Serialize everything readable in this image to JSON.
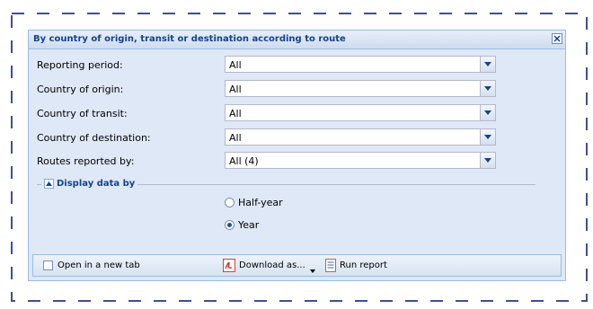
{
  "panel": {
    "title": "By country of origin, transit or destination according to route"
  },
  "form": {
    "rows": [
      {
        "label": "Reporting period:",
        "value": "All"
      },
      {
        "label": "Country of origin:",
        "value": "All"
      },
      {
        "label": "Country of transit:",
        "value": "All"
      },
      {
        "label": "Country of destination:",
        "value": "All"
      },
      {
        "label": "Routes reported by:",
        "value": "All (4)"
      }
    ]
  },
  "display": {
    "legend": "Display data by",
    "options": [
      {
        "label": "Half-year",
        "selected": false
      },
      {
        "label": "Year",
        "selected": true
      }
    ]
  },
  "footer": {
    "open_new_tab_label": "Open in a new tab",
    "open_new_tab_checked": false,
    "download_label": "Download as...",
    "run_report_label": "Run report"
  },
  "colors": {
    "frame_dash": "#3f4f8f",
    "panel_bg": "#dfe8f6",
    "header_text": "#15428b",
    "border": "#99bbe8"
  },
  "icons": {
    "close": "close-icon",
    "dropdown": "chevron-down-icon",
    "collapse": "collapse-arrow-icon",
    "pdf": "pdf-icon",
    "report": "report-icon"
  }
}
